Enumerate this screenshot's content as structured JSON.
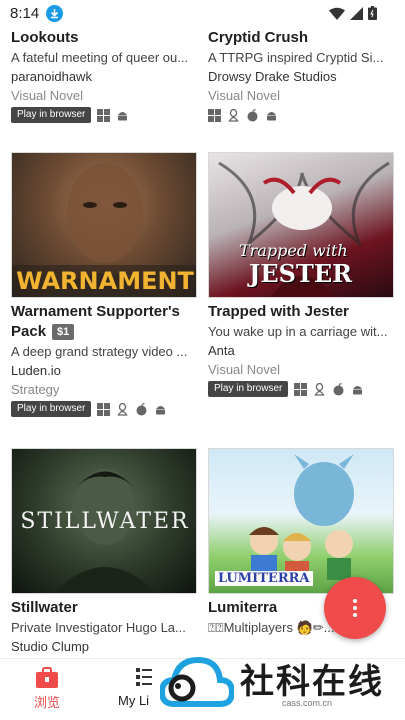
{
  "status": {
    "time": "8:14"
  },
  "games": [
    {
      "title": "Lookouts",
      "description": "A fateful meeting of queer ou...",
      "author": "paranoidhawk",
      "genre": "Visual Novel",
      "play_label": "Play in browser",
      "platforms": [
        "windows",
        "android"
      ]
    },
    {
      "title": "Cryptid Crush",
      "description": "A TTRPG inspired Cryptid Si...",
      "author": "Drowsy Drake Studios",
      "genre": "Visual Novel",
      "platforms": [
        "windows",
        "linux",
        "apple",
        "android"
      ]
    },
    {
      "title": "Warnament Supporter's",
      "title_line2": "Pack",
      "price": "$1",
      "cover_text": "WARNAMENT",
      "description": "A deep grand strategy video ...",
      "author": "Luden.io",
      "genre": "Strategy",
      "play_label": "Play in browser",
      "platforms": [
        "windows",
        "linux",
        "apple",
        "android"
      ]
    },
    {
      "title": "Trapped with Jester",
      "cover_text_line1": "Trapped with",
      "cover_text_line2": "JESTER",
      "description": "You wake up in a carriage wit...",
      "author": "Anta",
      "genre": "Visual Novel",
      "play_label": "Play in browser",
      "platforms": [
        "windows",
        "linux",
        "apple",
        "android"
      ]
    },
    {
      "title": "Stillwater",
      "cover_text": "STILLWATER",
      "description": "Private Investigator Hugo La...",
      "author": "Studio Clump"
    },
    {
      "title": "Lumiterra",
      "cover_text": "LUMITERRA",
      "description": "⍰⍰Multiplayers 🧑✏..."
    }
  ],
  "nav": {
    "browse_label": "浏览",
    "library_label": "My Li"
  },
  "watermark": {
    "text": "社科在线",
    "url": "cass.com.cn"
  },
  "colors": {
    "accent": "#f04b4b",
    "play_button": "#454545"
  }
}
